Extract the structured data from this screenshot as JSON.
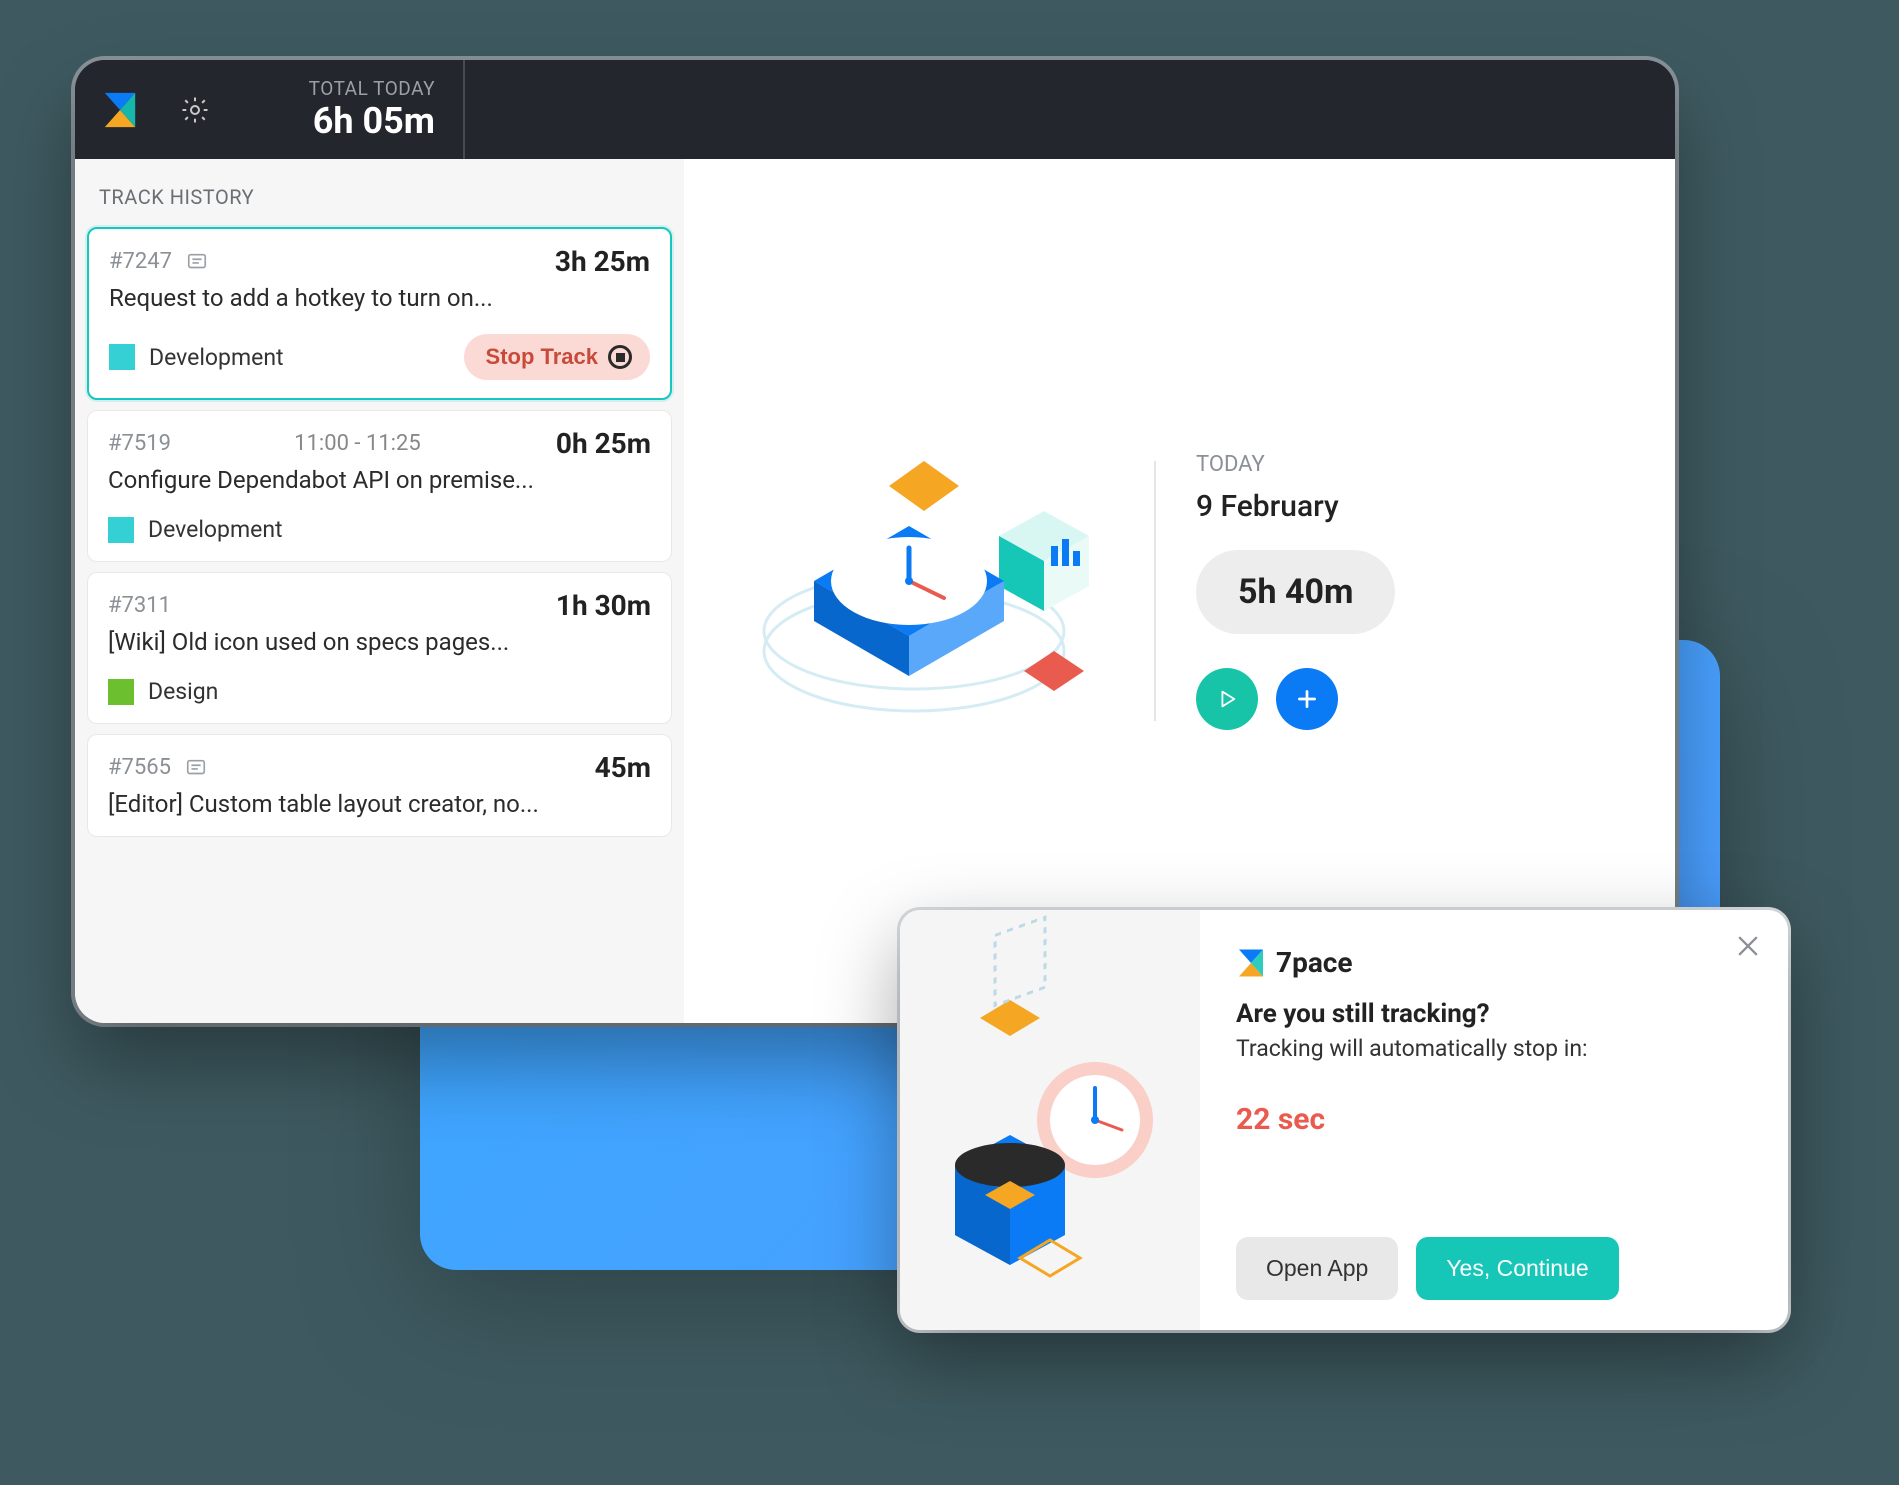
{
  "header": {
    "total_label": "TOTAL TODAY",
    "total_value": "6h 05m"
  },
  "left": {
    "section_title": "TRACK HISTORY",
    "stop_label": "Stop Track",
    "items": [
      {
        "id": "#7247",
        "has_note": true,
        "range": "",
        "duration": "3h 25m",
        "title": "Request to add a hotkey to turn on...",
        "category_color": "#34d0d3",
        "category": "Development",
        "active": true
      },
      {
        "id": "#7519",
        "has_note": false,
        "range": "11:00 - 11:25",
        "duration": "0h 25m",
        "title": "Configure Dependabot API on premise...",
        "category_color": "#34d0d3",
        "category": "Development",
        "active": false
      },
      {
        "id": "#7311",
        "has_note": false,
        "range": "",
        "duration": "1h 30m",
        "title": "[Wiki] Old icon used on specs pages...",
        "category_color": "#6cbf2e",
        "category": "Design",
        "active": false
      },
      {
        "id": "#7565",
        "has_note": true,
        "range": "",
        "duration": "45m",
        "title": "[Editor] Custom table layout creator, no...",
        "category_color": "",
        "category": "",
        "active": false
      }
    ]
  },
  "right": {
    "today_label": "TODAY",
    "today_date": "9 February",
    "summary_time": "5h 40m"
  },
  "toast": {
    "brand": "7pace",
    "heading": "Are you still tracking?",
    "subtext": "Tracking will automatically stop in:",
    "countdown": "22 sec",
    "open_label": "Open App",
    "continue_label": "Yes, Continue"
  },
  "colors": {
    "teal": "#16c7b8",
    "blue": "#0a7af5",
    "orange": "#f5a623",
    "coral": "#ea5b4f"
  }
}
